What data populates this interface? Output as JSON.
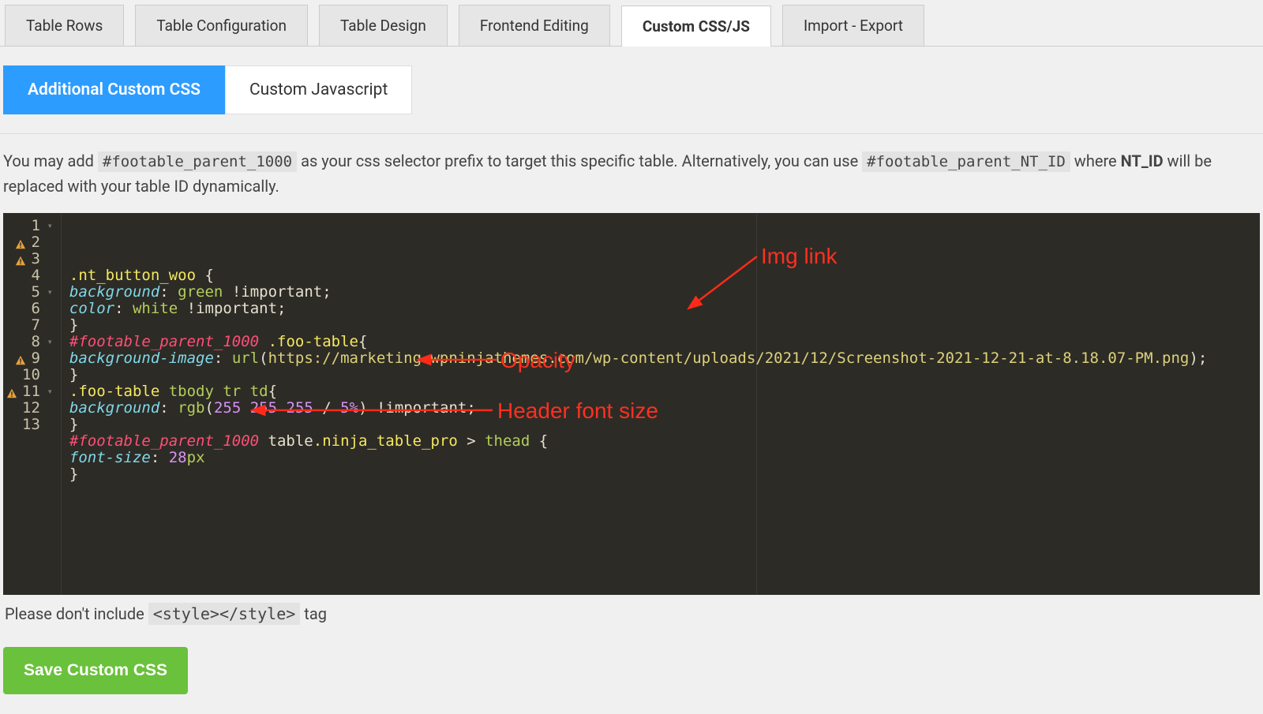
{
  "top_tabs": [
    {
      "label": "Table Rows",
      "active": false
    },
    {
      "label": "Table Configuration",
      "active": false
    },
    {
      "label": "Table Design",
      "active": false
    },
    {
      "label": "Frontend Editing",
      "active": false
    },
    {
      "label": "Custom CSS/JS",
      "active": true
    },
    {
      "label": "Import - Export",
      "active": false
    }
  ],
  "sub_tabs": [
    {
      "label": "Additional Custom CSS",
      "active": true
    },
    {
      "label": "Custom Javascript",
      "active": false
    }
  ],
  "help_text": {
    "prefix": "You may add ",
    "code1": "#footable_parent_1000",
    "mid1": " as your css selector prefix to target this specific table. Alternatively, you can use ",
    "code2": "#footable_parent_NT_ID",
    "mid2": " where ",
    "bold": "NT_ID",
    "suffix": " will be replaced with your table ID dynamically."
  },
  "gutter": [
    {
      "num": "1",
      "warn": false,
      "fold": true
    },
    {
      "num": "2",
      "warn": true,
      "fold": false
    },
    {
      "num": "3",
      "warn": true,
      "fold": false
    },
    {
      "num": "4",
      "warn": false,
      "fold": false
    },
    {
      "num": "5",
      "warn": false,
      "fold": true
    },
    {
      "num": "6",
      "warn": false,
      "fold": false
    },
    {
      "num": "7",
      "warn": false,
      "fold": false
    },
    {
      "num": "8",
      "warn": false,
      "fold": true
    },
    {
      "num": "9",
      "warn": true,
      "fold": false
    },
    {
      "num": "10",
      "warn": false,
      "fold": false
    },
    {
      "num": "11",
      "warn": true,
      "fold": true
    },
    {
      "num": "12",
      "warn": false,
      "fold": false
    },
    {
      "num": "13",
      "warn": false,
      "fold": false
    }
  ],
  "code_lines": [
    {
      "index": 1,
      "raw": ".nt_button_woo {",
      "tokens": [
        {
          "t": ".nt_button_woo ",
          "c": "tok-sel"
        },
        {
          "t": "{",
          "c": "tok-punct"
        }
      ]
    },
    {
      "index": 2,
      "raw": "background: green !important;",
      "tokens": [
        {
          "t": "background",
          "c": "tok-prop"
        },
        {
          "t": ": ",
          "c": "tok-punct"
        },
        {
          "t": "green",
          "c": "tok-val"
        },
        {
          "t": " !important",
          "c": "tok-imp"
        },
        {
          "t": ";",
          "c": "tok-punct"
        }
      ]
    },
    {
      "index": 3,
      "raw": "color: white !important;",
      "tokens": [
        {
          "t": "color",
          "c": "tok-prop"
        },
        {
          "t": ": ",
          "c": "tok-punct"
        },
        {
          "t": "white",
          "c": "tok-val"
        },
        {
          "t": " !important",
          "c": "tok-imp"
        },
        {
          "t": ";",
          "c": "tok-punct"
        }
      ]
    },
    {
      "index": 4,
      "raw": "}",
      "tokens": [
        {
          "t": "}",
          "c": "tok-punct"
        }
      ]
    },
    {
      "index": 5,
      "raw": "#footable_parent_1000 .foo-table{",
      "tokens": [
        {
          "t": "#footable_parent_1000",
          "c": "tok-id"
        },
        {
          "t": " ",
          "c": "tok-punct"
        },
        {
          "t": ".foo-table",
          "c": "tok-sel"
        },
        {
          "t": "{",
          "c": "tok-punct"
        }
      ]
    },
    {
      "index": 6,
      "raw": "background-image: url(https://marketing.wpninjathemes.com/wp-content/uploads/2021/12/Screenshot-2021-12-21-at-8.18.07-PM.png);",
      "tokens": [
        {
          "t": "background-image",
          "c": "tok-prop"
        },
        {
          "t": ": ",
          "c": "tok-punct"
        },
        {
          "t": "url",
          "c": "tok-val"
        },
        {
          "t": "(",
          "c": "tok-punct"
        },
        {
          "t": "https://marketing.wpninjathemes.com/wp-content/uploads/2021/12/Screenshot-2021-12-21-at-8.18.07-PM.png",
          "c": "tok-str"
        },
        {
          "t": ")",
          "c": "tok-punct"
        },
        {
          "t": ";",
          "c": "tok-punct"
        }
      ]
    },
    {
      "index": 7,
      "raw": "}",
      "tokens": [
        {
          "t": "}",
          "c": "tok-punct"
        }
      ]
    },
    {
      "index": 8,
      "raw": ".foo-table tbody tr td{",
      "tokens": [
        {
          "t": ".foo-table ",
          "c": "tok-sel"
        },
        {
          "t": "tbody tr td",
          "c": "tok-val"
        },
        {
          "t": "{",
          "c": "tok-punct"
        }
      ]
    },
    {
      "index": 9,
      "raw": "background: rgb(255 255 255 / 5%) !important;",
      "tokens": [
        {
          "t": "background",
          "c": "tok-prop"
        },
        {
          "t": ": ",
          "c": "tok-punct"
        },
        {
          "t": "rgb",
          "c": "tok-val"
        },
        {
          "t": "(",
          "c": "tok-punct"
        },
        {
          "t": "255",
          "c": "tok-num"
        },
        {
          "t": " ",
          "c": "tok-punct"
        },
        {
          "t": "255",
          "c": "tok-num"
        },
        {
          "t": " ",
          "c": "tok-punct"
        },
        {
          "t": "255",
          "c": "tok-num"
        },
        {
          "t": " / ",
          "c": "tok-punct"
        },
        {
          "t": "5%",
          "c": "tok-num"
        },
        {
          "t": ")",
          "c": "tok-punct"
        },
        {
          "t": " !important",
          "c": "tok-imp"
        },
        {
          "t": ";",
          "c": "tok-punct"
        }
      ]
    },
    {
      "index": 10,
      "raw": "}",
      "tokens": [
        {
          "t": "}",
          "c": "tok-punct"
        }
      ]
    },
    {
      "index": 11,
      "raw": "#footable_parent_1000 table.ninja_table_pro > thead {",
      "tokens": [
        {
          "t": "#footable_parent_1000",
          "c": "tok-id"
        },
        {
          "t": " table",
          "c": "tok-punct"
        },
        {
          "t": ".ninja_table_pro",
          "c": "tok-sel"
        },
        {
          "t": " > ",
          "c": "tok-punct"
        },
        {
          "t": "thead ",
          "c": "tok-val"
        },
        {
          "t": "{",
          "c": "tok-punct"
        }
      ]
    },
    {
      "index": 12,
      "raw": "font-size: 28px",
      "tokens": [
        {
          "t": "font-size",
          "c": "tok-prop"
        },
        {
          "t": ": ",
          "c": "tok-punct"
        },
        {
          "t": "28",
          "c": "tok-num"
        },
        {
          "t": "px",
          "c": "tok-val"
        }
      ]
    },
    {
      "index": 13,
      "raw": "}",
      "tokens": [
        {
          "t": "}",
          "c": "tok-punct"
        }
      ]
    }
  ],
  "annotations": {
    "img_link": "Img link",
    "opacity": "Opacity",
    "header_font": "Header font size"
  },
  "footer": {
    "prefix": "Please don't include ",
    "code": "<style></style>",
    "suffix": " tag"
  },
  "save_button": "Save Custom CSS"
}
